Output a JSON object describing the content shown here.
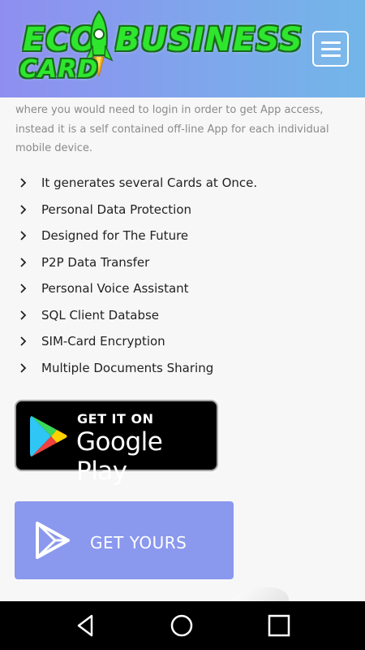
{
  "header": {
    "logo": {
      "line1_part1": "ECO",
      "line1_part2": "BUSINESS",
      "line2": "CARD",
      "icon": "rocket-icon"
    },
    "menu_icon": "hamburger-icon"
  },
  "intro_text": "where you would need to login in order to get App access, instead it is a self contained off-line App for each individual mobile device.",
  "features": [
    "It generates several Cards at Once.",
    "Personal Data Protection",
    "Designed for The Future",
    "P2P Data Transfer",
    "Personal Voice Assistant",
    "SQL Client Databse",
    "SIM-Card Encryption",
    "Multiple Documents Sharing"
  ],
  "google_play_badge": {
    "small_text": "GET IT ON",
    "big_text": "Google Play",
    "icon": "google-play-icon"
  },
  "get_yours_button": {
    "label": "GET YOURS",
    "icon": "play-outline-icon",
    "color": "#8a98ee"
  },
  "android_nav": {
    "back": "back-icon",
    "home": "home-icon",
    "recent": "recent-apps-icon"
  },
  "colors": {
    "header_gradient_start": "#8f8ef0",
    "header_gradient_end": "#72b6e8",
    "logo_green": "#2ee62e",
    "body_text": "#222222",
    "muted_text": "#8a8a8a"
  }
}
